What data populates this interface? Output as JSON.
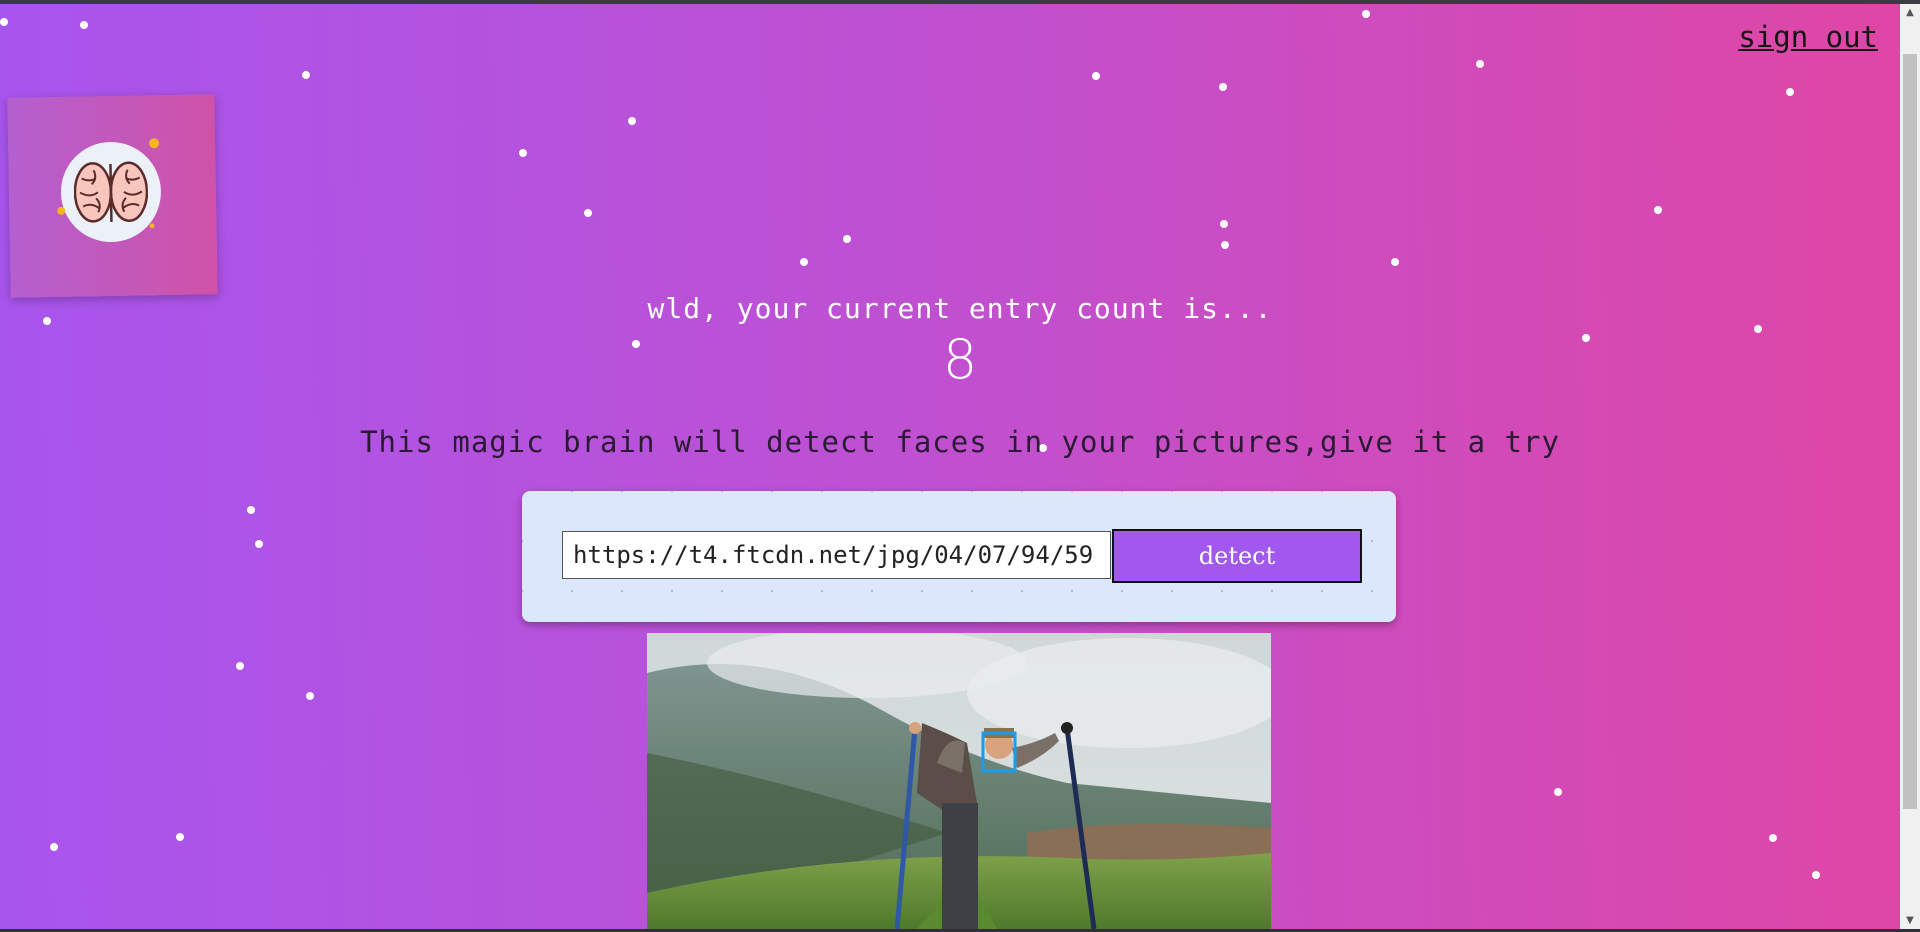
{
  "header": {
    "signout_label": "sign out"
  },
  "logo": {
    "icon": "brain-icon"
  },
  "rank": {
    "greeting": "wld, your current entry count is...",
    "count": "8"
  },
  "main": {
    "tagline": "This magic brain will detect faces in your pictures,give it a try",
    "url_input_value": "https://t4.ftcdn.net/jpg/04/07/94/59",
    "detect_label": "detect"
  },
  "colors": {
    "gradient_start": "#a855ee",
    "gradient_end": "#e046a4",
    "button": "#a258ee",
    "face_box": "#149df2"
  }
}
